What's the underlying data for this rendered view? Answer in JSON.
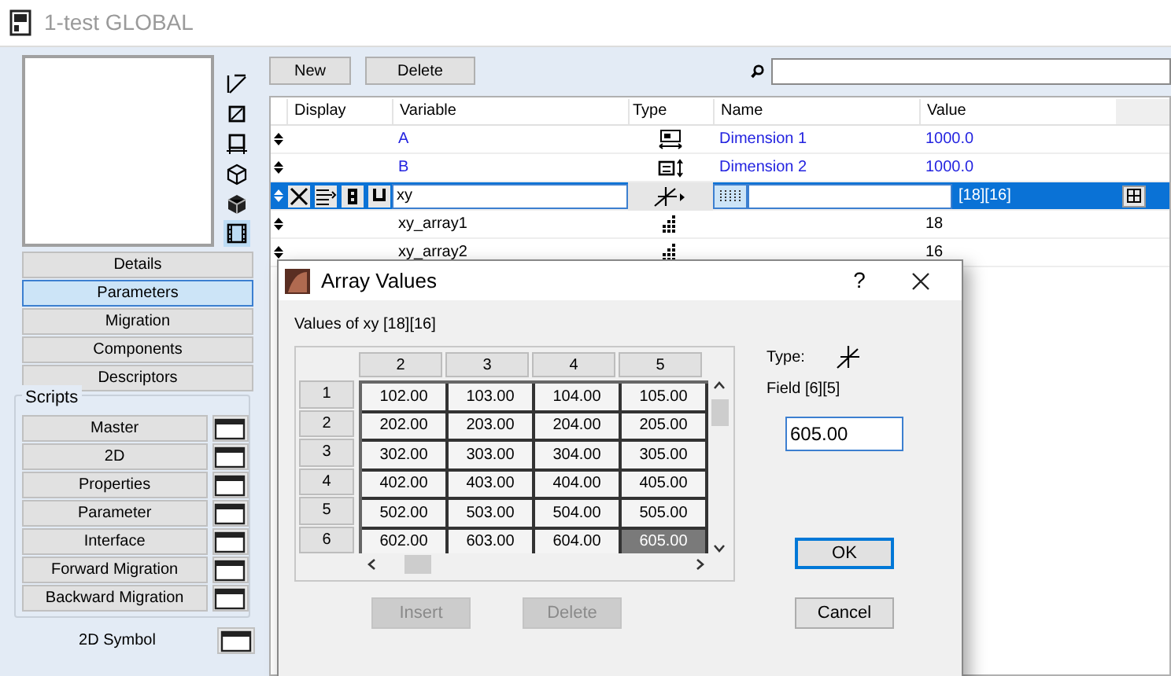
{
  "window": {
    "title": "1-test GLOBAL"
  },
  "sidebar": {
    "view_icons": [
      {
        "selected": false
      },
      {
        "selected": false
      },
      {
        "selected": false
      },
      {
        "selected": false
      },
      {
        "selected": false
      },
      {
        "selected": true
      }
    ],
    "pages": [
      {
        "label": "Details",
        "selected": false
      },
      {
        "label": "Parameters",
        "selected": true
      },
      {
        "label": "Migration",
        "selected": false
      },
      {
        "label": "Components",
        "selected": false
      },
      {
        "label": "Descriptors",
        "selected": false
      }
    ],
    "scripts_label": "Scripts",
    "scripts": [
      {
        "label": "Master"
      },
      {
        "label": "2D"
      },
      {
        "label": "Properties"
      },
      {
        "label": "Parameter"
      },
      {
        "label": "Interface"
      },
      {
        "label": "Forward Migration"
      },
      {
        "label": "Backward Migration"
      }
    ],
    "extra_scripts": [
      {
        "label": "2D Symbol"
      }
    ]
  },
  "toolbar": {
    "buttons": [
      "New",
      "Delete"
    ]
  },
  "table": {
    "columns": [
      "Display",
      "Variable",
      "Type",
      "Name",
      "Value"
    ],
    "rows": [
      {
        "variable": "A",
        "kind": "length-x",
        "name": "Dimension 1",
        "value": "1000.0",
        "highlighted": true,
        "selected": false
      },
      {
        "variable": "B",
        "kind": "length-y",
        "name": "Dimension 2",
        "value": "1000.0",
        "highlighted": true,
        "selected": false
      },
      {
        "variable": "xy",
        "kind": "angle",
        "value": "[18][16]",
        "highlighted": false,
        "selected": true
      },
      {
        "variable": "xy_array1",
        "kind": "integer",
        "value": "18",
        "highlighted": false,
        "selected": false
      },
      {
        "variable": "xy_array2",
        "kind": "integer",
        "value": "16",
        "highlighted": false,
        "selected": false
      }
    ]
  },
  "dialog": {
    "title": "Array Values",
    "help": "?",
    "values_label": "Values of xy [18][16]",
    "columns": [
      "2",
      "3",
      "4",
      "5"
    ],
    "rows": [
      {
        "header": "1",
        "cells": [
          {
            "text": "102.00",
            "selected": false
          },
          {
            "text": "103.00",
            "selected": false
          },
          {
            "text": "104.00",
            "selected": false
          },
          {
            "text": "105.00",
            "selected": false
          }
        ]
      },
      {
        "header": "2",
        "cells": [
          {
            "text": "202.00",
            "selected": false
          },
          {
            "text": "203.00",
            "selected": false
          },
          {
            "text": "204.00",
            "selected": false
          },
          {
            "text": "205.00",
            "selected": false
          }
        ]
      },
      {
        "header": "3",
        "cells": [
          {
            "text": "302.00",
            "selected": false
          },
          {
            "text": "303.00",
            "selected": false
          },
          {
            "text": "304.00",
            "selected": false
          },
          {
            "text": "305.00",
            "selected": false
          }
        ]
      },
      {
        "header": "4",
        "cells": [
          {
            "text": "402.00",
            "selected": false
          },
          {
            "text": "403.00",
            "selected": false
          },
          {
            "text": "404.00",
            "selected": false
          },
          {
            "text": "405.00",
            "selected": false
          }
        ]
      },
      {
        "header": "5",
        "cells": [
          {
            "text": "502.00",
            "selected": false
          },
          {
            "text": "503.00",
            "selected": false
          },
          {
            "text": "504.00",
            "selected": false
          },
          {
            "text": "505.00",
            "selected": false
          }
        ]
      },
      {
        "header": "6",
        "cells": [
          {
            "text": "602.00",
            "selected": false
          },
          {
            "text": "603.00",
            "selected": false
          },
          {
            "text": "604.00",
            "selected": false
          },
          {
            "text": "605.00",
            "selected": true
          }
        ]
      }
    ],
    "buttons": [
      {
        "label": "Insert",
        "disabled": true
      },
      {
        "label": "Delete",
        "disabled": true
      }
    ],
    "type_label": "Type:",
    "field_label": "Field [6][5]",
    "field_value": "605.00",
    "ok": {
      "label": "OK",
      "default": true
    },
    "cancel": {
      "label": "Cancel",
      "default": false
    }
  }
}
